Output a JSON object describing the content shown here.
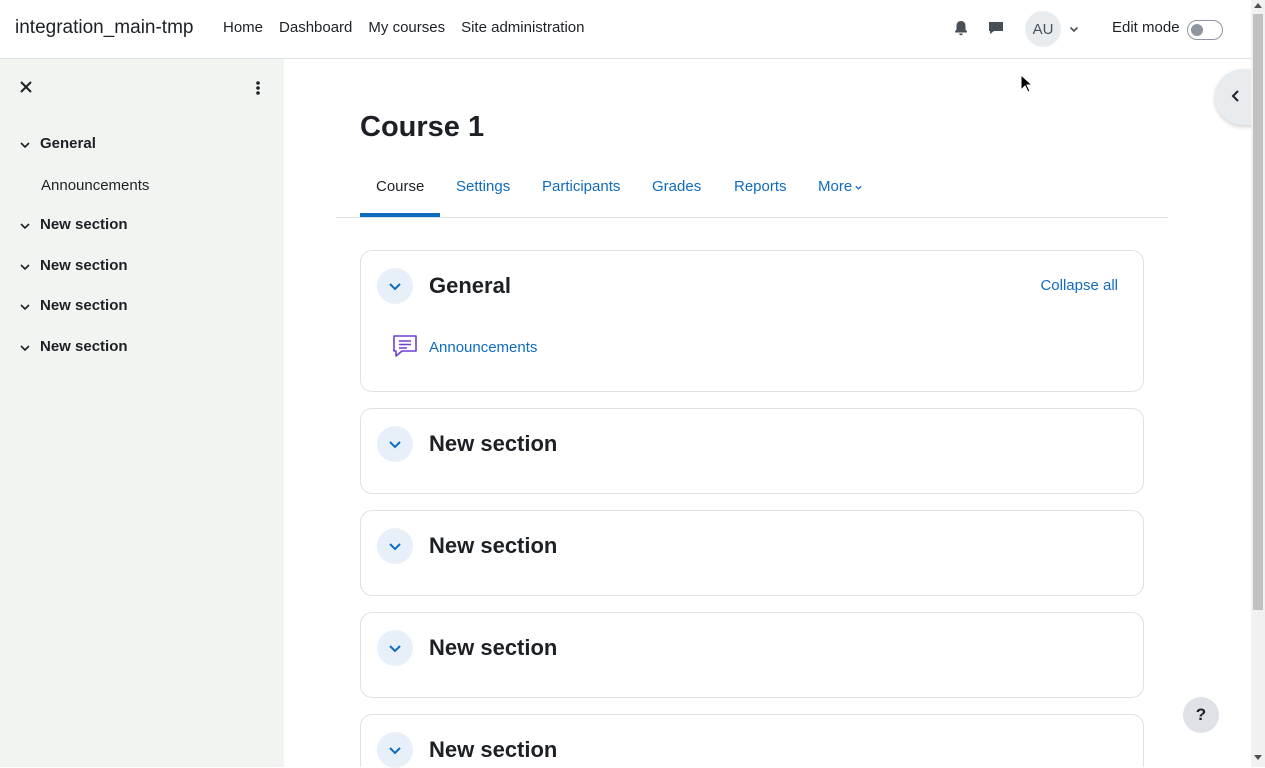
{
  "site": {
    "name": "integration_main-tmp"
  },
  "primary_nav": [
    {
      "label": "Home"
    },
    {
      "label": "Dashboard"
    },
    {
      "label": "My courses"
    },
    {
      "label": "Site administration"
    }
  ],
  "user_menu": {
    "initials": "AU"
  },
  "edit_mode": {
    "label": "Edit mode",
    "enabled": false
  },
  "course_index": {
    "items": [
      {
        "label": "General",
        "expanded": true,
        "activities": [
          {
            "label": "Announcements"
          }
        ]
      },
      {
        "label": "New section",
        "expanded": true
      },
      {
        "label": "New section",
        "expanded": true
      },
      {
        "label": "New section",
        "expanded": true
      },
      {
        "label": "New section",
        "expanded": true
      }
    ]
  },
  "page": {
    "title": "Course 1"
  },
  "secondary_nav": {
    "tabs": [
      {
        "label": "Course",
        "active": true
      },
      {
        "label": "Settings"
      },
      {
        "label": "Participants"
      },
      {
        "label": "Grades"
      },
      {
        "label": "Reports"
      },
      {
        "label": "More"
      }
    ]
  },
  "sections": [
    {
      "title": "General",
      "activities": [
        {
          "label": "Announcements",
          "icon": "forum-icon"
        }
      ]
    },
    {
      "title": "New section"
    },
    {
      "title": "New section"
    },
    {
      "title": "New section"
    },
    {
      "title": "New section"
    }
  ],
  "collapse_all_label": "Collapse all",
  "help_label": "?",
  "colors": {
    "accent": "#0f6cbf",
    "drawer_bg": "#f1f4f1",
    "forum_icon": "#6f3fd0"
  }
}
